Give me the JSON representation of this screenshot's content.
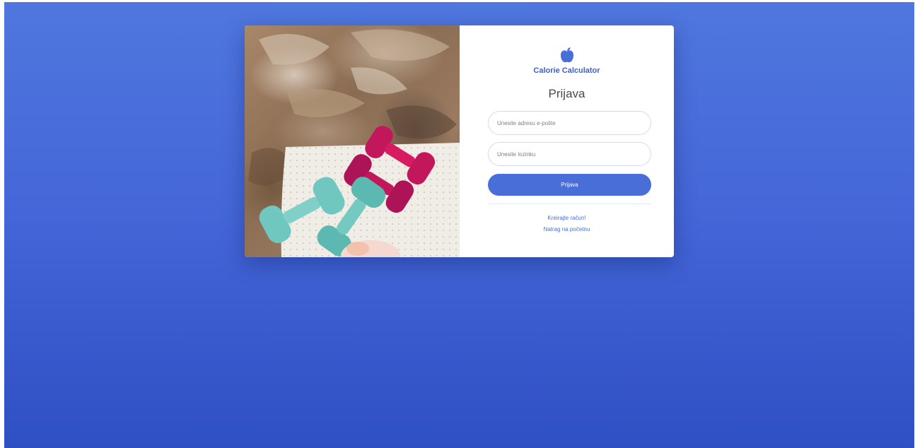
{
  "app": {
    "brand": "Calorie Calculator",
    "logo_icon": "apple-icon"
  },
  "login": {
    "title": "Prijava",
    "email_placeholder": "Unesite adresu e-pošte",
    "password_placeholder": "Unesite lozinku",
    "submit_label": "Prijava",
    "register_link": "Kreirajte račun!",
    "home_link": "Natrag na početnu"
  },
  "colors": {
    "accent": "#4a6ed8",
    "background_top": "#4f77de",
    "background_bottom": "#2f4fc4"
  }
}
